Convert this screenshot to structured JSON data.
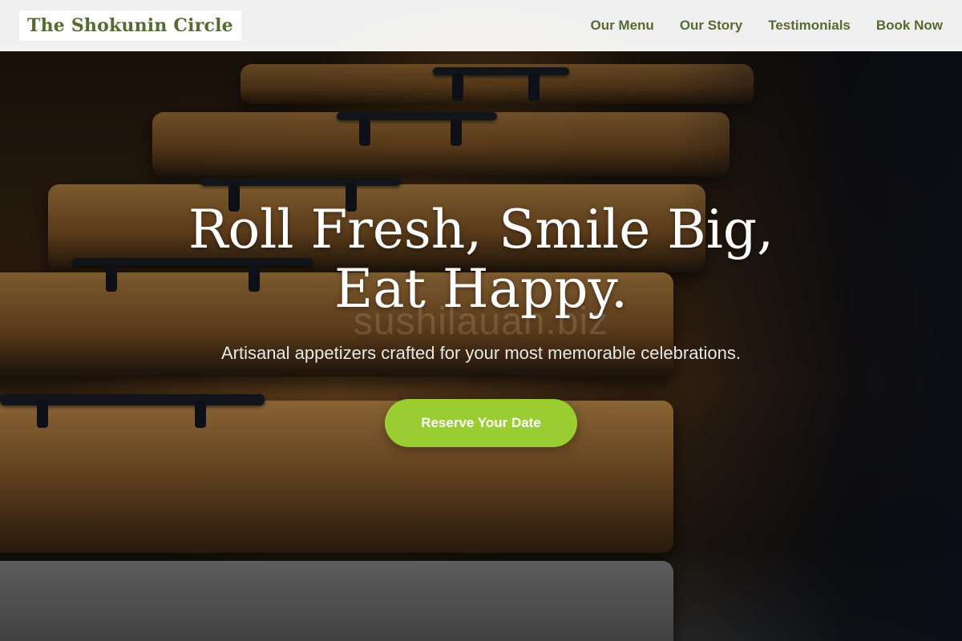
{
  "header": {
    "logo": "The Shokunin Circle",
    "nav": [
      {
        "label": "Our Menu"
      },
      {
        "label": "Our Story"
      },
      {
        "label": "Testimonials"
      },
      {
        "label": "Book Now"
      }
    ]
  },
  "hero": {
    "headline": "Roll Fresh, Smile Big, Eat Happy.",
    "watermark": "sushilauan.biz",
    "subheadline": "Artisanal appetizers crafted for your most memorable celebrations.",
    "cta_label": "Reserve Your Date"
  },
  "colors": {
    "brand_green": "#556b2f",
    "cta_green": "#9acd32"
  }
}
